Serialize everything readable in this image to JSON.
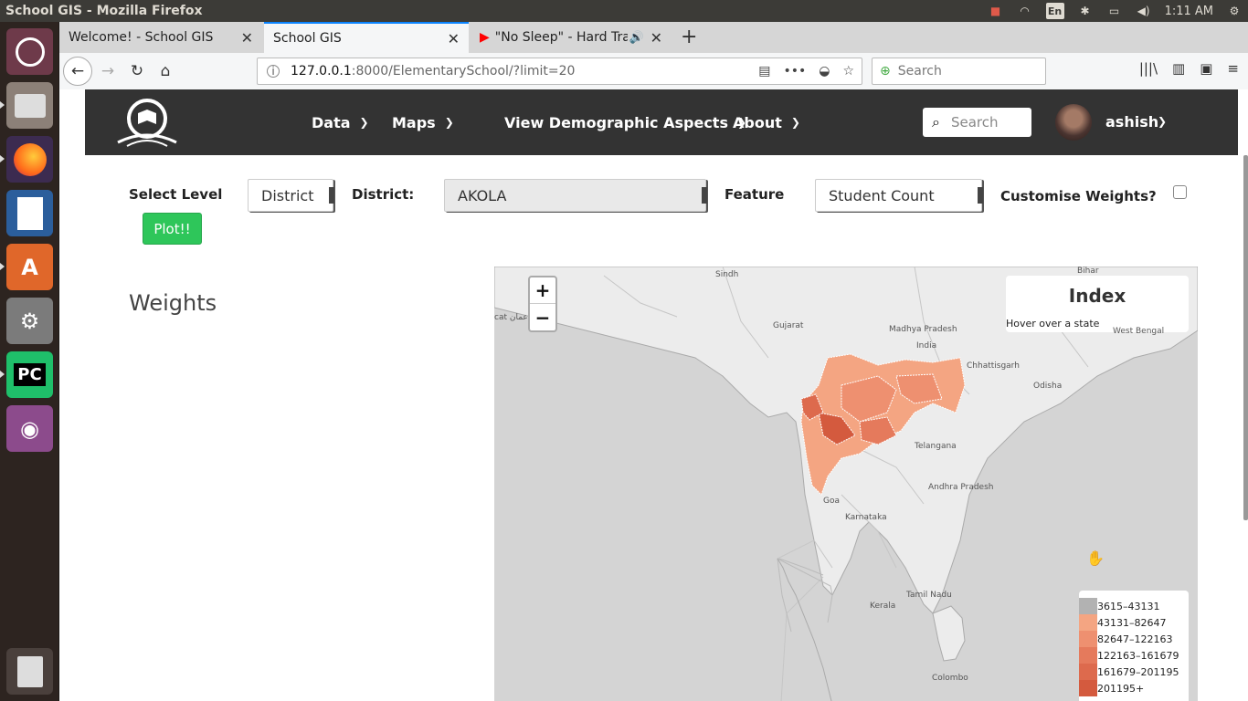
{
  "window": {
    "title": "School GIS - Mozilla Firefox",
    "time": "1:11 AM",
    "keyboard": "En"
  },
  "tabs": [
    {
      "label": "Welcome! - School GIS",
      "active": false
    },
    {
      "label": "School GIS",
      "active": true
    },
    {
      "label": "\"No Sleep\" - Hard Trap",
      "active": false
    }
  ],
  "browser": {
    "url_host": "127.0.0.1",
    "url_rest": ":8000/ElementarySchool/?limit=20",
    "search_placeholder": "Search"
  },
  "site": {
    "menu": [
      "Data",
      "Maps",
      "View Demographic Aspects",
      "About"
    ],
    "search_placeholder": "Search",
    "username": "ashish"
  },
  "form": {
    "select_level_label": "Select Level",
    "level_value": "District",
    "district_label": "District:",
    "district_value": "AKOLA",
    "feature_label": "Feature",
    "feature_value": "Student Count",
    "customise_label": "Customise Weights?",
    "plot_label": "Plot!!"
  },
  "weights_title": "Weights",
  "map": {
    "zoom_in": "+",
    "zoom_out": "−",
    "index_title": "Index",
    "index_hint": "Hover over a state",
    "labels": [
      "Sindh",
      "Bihar",
      "Gujarat",
      "Madhya Pradesh",
      "India",
      "Chhattisgarh",
      "Odisha",
      "West Bengal",
      "Telangana",
      "Andhra Pradesh",
      "Goa",
      "Karnataka",
      "Tamil Nadu",
      "Kerala",
      "Colombo",
      "cat عمان"
    ],
    "legend": [
      {
        "label": "3615–43131",
        "color": "#b2b2b2"
      },
      {
        "label": "43131–82647",
        "color": "#f4a582"
      },
      {
        "label": "82647–122163",
        "color": "#ee9070"
      },
      {
        "label": "122163–161679",
        "color": "#e57a5c"
      },
      {
        "label": "161679–201195",
        "color": "#dd6a4d"
      },
      {
        "label": "201195+",
        "color": "#d45a3e"
      }
    ]
  }
}
